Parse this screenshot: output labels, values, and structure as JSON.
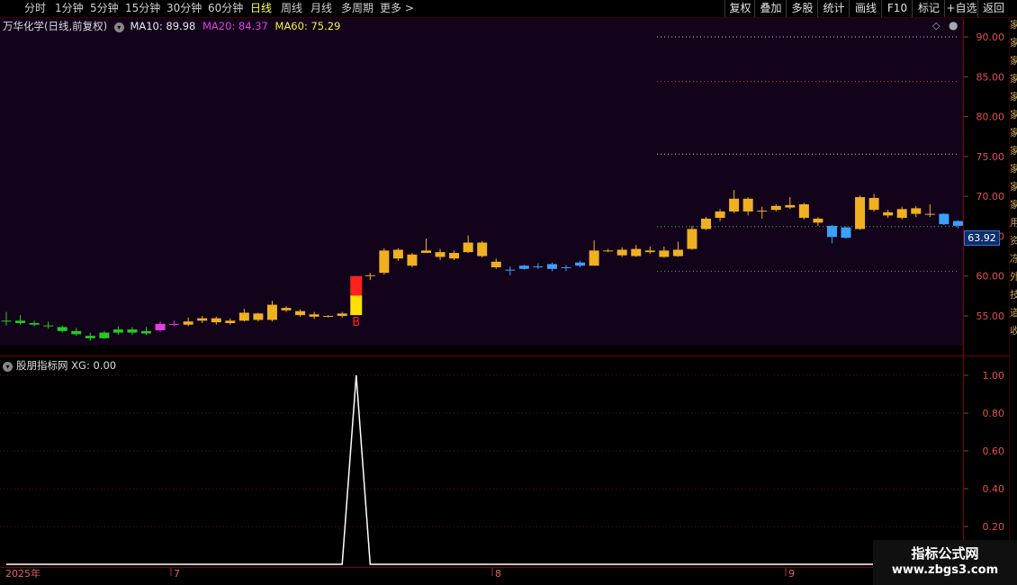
{
  "toolbar": {
    "periods": [
      "分时",
      "1分钟",
      "5分钟",
      "15分钟",
      "30分钟",
      "60分钟",
      "日线",
      "周线",
      "月线",
      "多周期",
      "更多 >"
    ],
    "active_period": "日线",
    "actions": [
      "复权",
      "叠加",
      "多股",
      "统计",
      "画线",
      "F10",
      "标记",
      "+自选",
      "返回"
    ]
  },
  "main_chart": {
    "title": "万华化学(日线,前复权)",
    "ma": [
      {
        "label": "MA10: 89.98",
        "color": "#e8e8e8"
      },
      {
        "label": "MA20: 84.37",
        "color": "#e040e0"
      },
      {
        "label": "MA60: 75.29",
        "color": "#f0f040"
      }
    ],
    "price_ticks": [
      "90.00",
      "85.00",
      "80.00",
      "75.00",
      "70.00",
      "65.00",
      "60.00",
      "55.00"
    ],
    "last_price": "63.92",
    "signal_label": "B"
  },
  "sub_chart": {
    "title": "股朋指标网 XG: 0.00",
    "ticks": [
      "1.00",
      "0.80",
      "0.60",
      "0.40",
      "0.20"
    ]
  },
  "date_axis": [
    "2025年",
    "7",
    "8",
    "9"
  ],
  "right_strip_chars": [
    "家",
    "家",
    "家",
    "家",
    "家",
    "家",
    "家",
    "家",
    "家",
    "家",
    "家",
    "用",
    "资",
    "冻",
    "外",
    "技",
    "道",
    "收"
  ],
  "watermark": {
    "title": "指标公式网",
    "url": "www.zbgs3.com"
  },
  "chart_data": [
    {
      "type": "candlestick",
      "title": "万华化学(日线,前复权)",
      "ylim": [
        50.5,
        91
      ],
      "reference_levels": [
        {
          "value": 90.0,
          "color": "#c8c8c8",
          "style": "dotted"
        },
        {
          "value": 84.4,
          "color": "#e04040",
          "style": "dotted"
        },
        {
          "value": 75.3,
          "color": "#c8c8c8",
          "style": "dotted"
        },
        {
          "value": 66.2,
          "color": "#40c040",
          "style": "dotted"
        },
        {
          "value": 60.6,
          "color": "#888888",
          "style": "dotted"
        }
      ],
      "candles": [
        {
          "o": 54.3,
          "c": 54.4,
          "h": 55.5,
          "l": 53.8,
          "color": "#22cc22"
        },
        {
          "o": 54.1,
          "c": 54.4,
          "h": 55.1,
          "l": 53.9,
          "color": "#22cc22"
        },
        {
          "o": 54.1,
          "c": 53.9,
          "h": 54.4,
          "l": 53.7,
          "color": "#22cc22"
        },
        {
          "o": 53.8,
          "c": 53.7,
          "h": 54.3,
          "l": 53.4,
          "color": "#22cc22"
        },
        {
          "o": 53.6,
          "c": 53.1,
          "h": 53.8,
          "l": 52.9,
          "color": "#22cc22"
        },
        {
          "o": 53.1,
          "c": 52.7,
          "h": 53.5,
          "l": 52.5,
          "color": "#22cc22"
        },
        {
          "o": 52.5,
          "c": 52.2,
          "h": 52.9,
          "l": 51.9,
          "color": "#22cc22"
        },
        {
          "o": 52.9,
          "c": 52.2,
          "h": 53.1,
          "l": 52.1,
          "color": "#22cc22"
        },
        {
          "o": 53.3,
          "c": 52.9,
          "h": 53.7,
          "l": 52.6,
          "color": "#22cc22"
        },
        {
          "o": 53.3,
          "c": 52.9,
          "h": 53.6,
          "l": 52.6,
          "color": "#22cc22"
        },
        {
          "o": 53.1,
          "c": 52.8,
          "h": 53.6,
          "l": 52.6,
          "color": "#22cc22"
        },
        {
          "o": 53.2,
          "c": 54.0,
          "h": 54.3,
          "l": 53.0,
          "color": "#e040e0"
        },
        {
          "o": 54.0,
          "c": 54.0,
          "h": 54.4,
          "l": 53.7,
          "color": "#e040e0"
        },
        {
          "o": 53.9,
          "c": 54.3,
          "h": 54.8,
          "l": 53.7,
          "color": "#f0b020"
        },
        {
          "o": 54.4,
          "c": 54.7,
          "h": 55.0,
          "l": 54.1,
          "color": "#f0b020"
        },
        {
          "o": 54.2,
          "c": 54.7,
          "h": 54.9,
          "l": 53.9,
          "color": "#f0b020"
        },
        {
          "o": 54.1,
          "c": 54.4,
          "h": 54.7,
          "l": 53.9,
          "color": "#f0b020"
        },
        {
          "o": 54.4,
          "c": 55.4,
          "h": 55.9,
          "l": 54.3,
          "color": "#f0b020"
        },
        {
          "o": 54.5,
          "c": 55.3,
          "h": 55.4,
          "l": 54.3,
          "color": "#f0b020"
        },
        {
          "o": 54.5,
          "c": 56.4,
          "h": 56.9,
          "l": 54.3,
          "color": "#f0b020"
        },
        {
          "o": 55.7,
          "c": 56.0,
          "h": 56.2,
          "l": 55.5,
          "color": "#f0b020"
        },
        {
          "o": 55.1,
          "c": 55.6,
          "h": 55.8,
          "l": 54.9,
          "color": "#f0b020"
        },
        {
          "o": 54.9,
          "c": 55.2,
          "h": 55.5,
          "l": 54.6,
          "color": "#f0b020"
        },
        {
          "o": 54.9,
          "c": 55.0,
          "h": 55.1,
          "l": 54.8,
          "color": "#f0b020"
        },
        {
          "o": 55.0,
          "c": 55.3,
          "h": 55.5,
          "l": 54.8,
          "color": "#f0b020"
        },
        {
          "o": 55.1,
          "c": 60.0,
          "h": 60.0,
          "l": 55.1,
          "color": "#ffe000",
          "upper_color": "#ff2020"
        },
        {
          "o": 60.1,
          "c": 60.1,
          "h": 60.4,
          "l": 59.5,
          "color": "#f0b020"
        },
        {
          "o": 60.4,
          "c": 63.2,
          "h": 63.5,
          "l": 60.2,
          "color": "#f0b020"
        },
        {
          "o": 62.2,
          "c": 63.3,
          "h": 63.5,
          "l": 61.9,
          "color": "#f0b020"
        },
        {
          "o": 61.3,
          "c": 62.7,
          "h": 62.9,
          "l": 61.1,
          "color": "#f0b020"
        },
        {
          "o": 62.9,
          "c": 63.2,
          "h": 64.7,
          "l": 62.9,
          "color": "#f0b020"
        },
        {
          "o": 62.4,
          "c": 63.0,
          "h": 63.4,
          "l": 62.0,
          "color": "#f0b020"
        },
        {
          "o": 62.2,
          "c": 62.9,
          "h": 63.2,
          "l": 62.0,
          "color": "#f0b020"
        },
        {
          "o": 63.0,
          "c": 64.2,
          "h": 65.1,
          "l": 62.9,
          "color": "#f0b020"
        },
        {
          "o": 62.5,
          "c": 64.2,
          "h": 64.4,
          "l": 62.3,
          "color": "#f0b020"
        },
        {
          "o": 61.1,
          "c": 61.8,
          "h": 62.2,
          "l": 60.9,
          "color": "#f0b020"
        },
        {
          "o": 60.8,
          "c": 60.8,
          "h": 61.2,
          "l": 60.1,
          "color": "#3ba0ff"
        },
        {
          "o": 60.9,
          "c": 61.3,
          "h": 61.4,
          "l": 60.8,
          "color": "#3ba0ff"
        },
        {
          "o": 61.2,
          "c": 61.2,
          "h": 61.6,
          "l": 60.9,
          "color": "#3ba0ff"
        },
        {
          "o": 61.5,
          "c": 60.9,
          "h": 61.7,
          "l": 60.6,
          "color": "#3ba0ff"
        },
        {
          "o": 61.1,
          "c": 61.1,
          "h": 61.4,
          "l": 60.6,
          "color": "#3ba0ff"
        },
        {
          "o": 61.3,
          "c": 61.7,
          "h": 61.9,
          "l": 61.1,
          "color": "#3ba0ff"
        },
        {
          "o": 61.3,
          "c": 63.2,
          "h": 64.5,
          "l": 61.3,
          "color": "#f0b020"
        },
        {
          "o": 63.1,
          "c": 63.2,
          "h": 63.4,
          "l": 63.0,
          "color": "#f0b020"
        },
        {
          "o": 62.6,
          "c": 63.3,
          "h": 63.6,
          "l": 62.4,
          "color": "#f0b020"
        },
        {
          "o": 62.5,
          "c": 63.4,
          "h": 63.9,
          "l": 62.4,
          "color": "#f0b020"
        },
        {
          "o": 63.0,
          "c": 63.2,
          "h": 63.7,
          "l": 62.8,
          "color": "#f0b020"
        },
        {
          "o": 62.4,
          "c": 63.2,
          "h": 63.7,
          "l": 62.3,
          "color": "#f0b020"
        },
        {
          "o": 62.5,
          "c": 63.3,
          "h": 64.3,
          "l": 62.4,
          "color": "#f0b020"
        },
        {
          "o": 63.4,
          "c": 65.9,
          "h": 66.3,
          "l": 63.3,
          "color": "#f0b020"
        },
        {
          "o": 65.9,
          "c": 67.2,
          "h": 67.4,
          "l": 65.8,
          "color": "#f0b020"
        },
        {
          "o": 67.3,
          "c": 68.1,
          "h": 68.4,
          "l": 66.9,
          "color": "#f0b020"
        },
        {
          "o": 68.1,
          "c": 69.7,
          "h": 70.8,
          "l": 67.9,
          "color": "#f0b020"
        },
        {
          "o": 68.1,
          "c": 69.7,
          "h": 69.9,
          "l": 67.6,
          "color": "#f0b020"
        },
        {
          "o": 68.1,
          "c": 68.2,
          "h": 68.7,
          "l": 67.2,
          "color": "#f0b020"
        },
        {
          "o": 68.3,
          "c": 68.8,
          "h": 69.0,
          "l": 68.1,
          "color": "#f0b020"
        },
        {
          "o": 68.6,
          "c": 68.9,
          "h": 69.9,
          "l": 68.4,
          "color": "#f0b020"
        },
        {
          "o": 67.3,
          "c": 69.0,
          "h": 69.2,
          "l": 67.1,
          "color": "#f0b020"
        },
        {
          "o": 66.7,
          "c": 67.2,
          "h": 67.4,
          "l": 66.3,
          "color": "#f0b020"
        },
        {
          "o": 66.3,
          "c": 64.9,
          "h": 66.4,
          "l": 64.1,
          "color": "#3ba0ff"
        },
        {
          "o": 66.1,
          "c": 64.8,
          "h": 66.2,
          "l": 64.7,
          "color": "#3ba0ff"
        },
        {
          "o": 65.9,
          "c": 69.9,
          "h": 70.1,
          "l": 65.8,
          "color": "#f0b020"
        },
        {
          "o": 68.3,
          "c": 69.8,
          "h": 70.3,
          "l": 68.1,
          "color": "#f0b020"
        },
        {
          "o": 67.6,
          "c": 68.0,
          "h": 68.3,
          "l": 67.3,
          "color": "#f0b020"
        },
        {
          "o": 67.3,
          "c": 68.4,
          "h": 68.7,
          "l": 67.1,
          "color": "#f0b020"
        },
        {
          "o": 67.8,
          "c": 68.5,
          "h": 68.8,
          "l": 67.4,
          "color": "#f0b020"
        },
        {
          "o": 67.8,
          "c": 67.8,
          "h": 69.0,
          "l": 67.4,
          "color": "#f0b020"
        },
        {
          "o": 67.8,
          "c": 66.5,
          "h": 67.9,
          "l": 66.4,
          "color": "#3ba0ff"
        },
        {
          "o": 66.9,
          "c": 66.3,
          "h": 67.0,
          "l": 66.0,
          "color": "#3ba0ff"
        }
      ]
    },
    {
      "type": "line",
      "title": "股朋指标网 XG: 0.00",
      "ylim": [
        0,
        1.05
      ],
      "series": [
        {
          "name": "XG",
          "color": "#ffffff",
          "values": [
            0,
            0,
            0,
            0,
            0,
            0,
            0,
            0,
            0,
            0,
            0,
            0,
            0,
            0,
            0,
            0,
            0,
            0,
            0,
            0,
            0,
            0,
            0,
            0,
            0,
            1,
            0,
            0,
            0,
            0,
            0,
            0,
            0,
            0,
            0,
            0,
            0,
            0,
            0,
            0,
            0,
            0,
            0,
            0,
            0,
            0,
            0,
            0,
            0,
            0,
            0,
            0,
            0,
            0,
            0,
            0,
            0,
            0,
            0,
            0,
            0,
            0,
            0,
            0,
            0,
            0,
            0,
            0,
            0
          ]
        }
      ]
    }
  ]
}
